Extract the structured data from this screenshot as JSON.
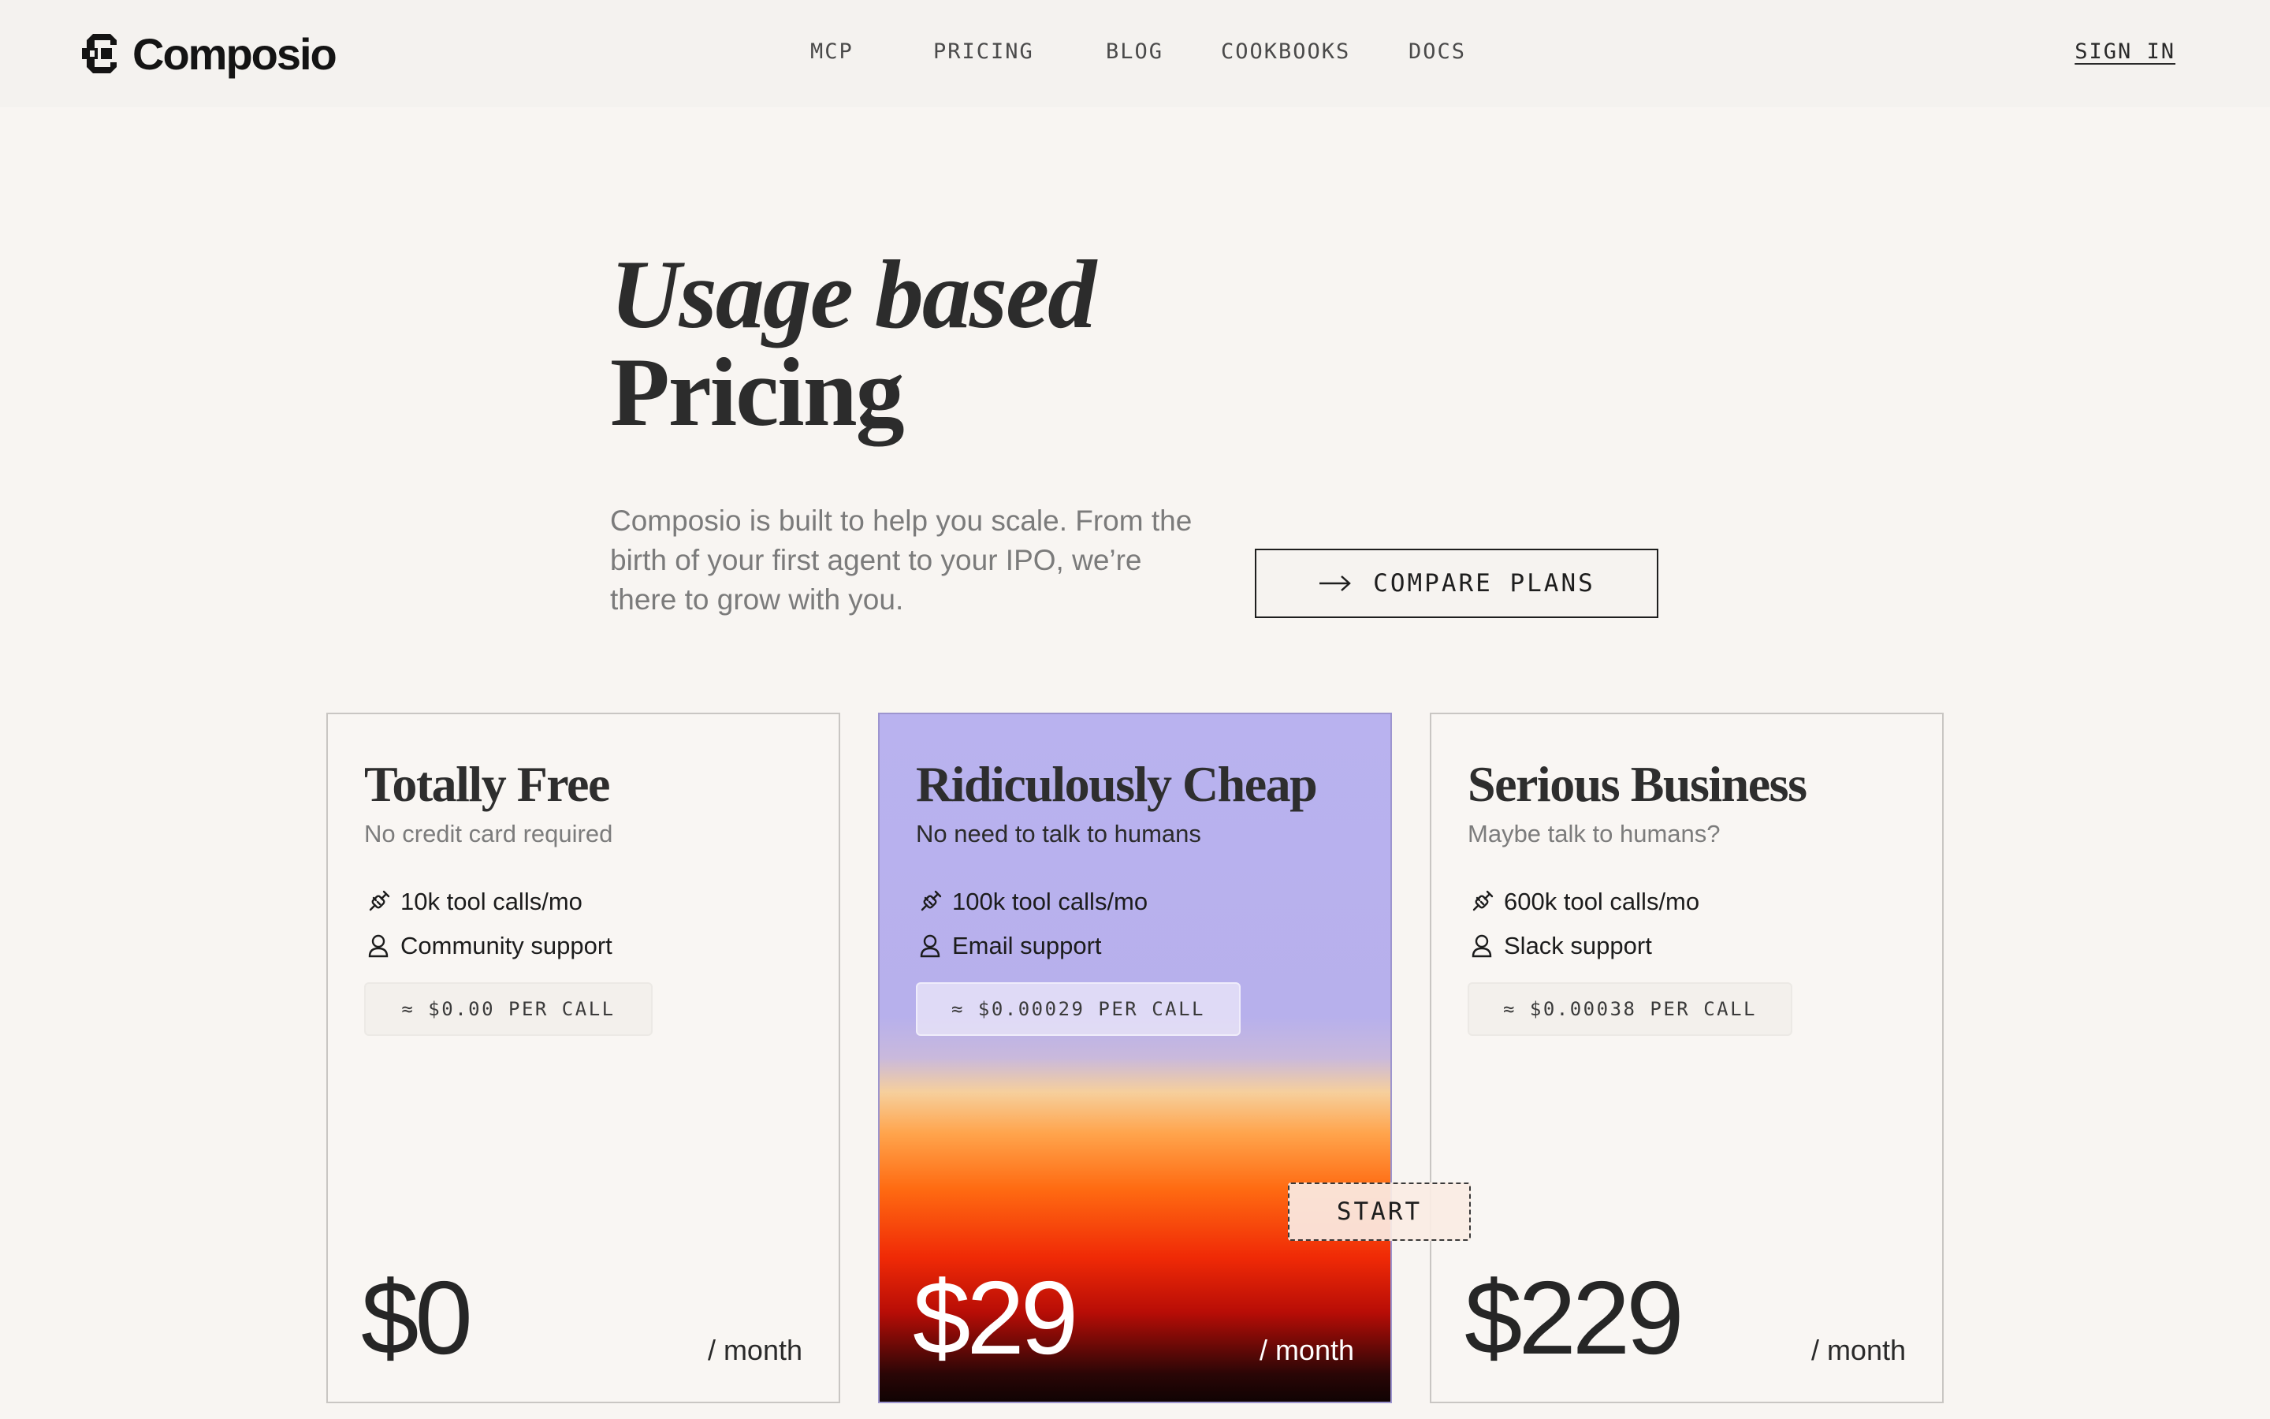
{
  "brand": {
    "name": "Composio",
    "logo_icon": "composio-logo-icon"
  },
  "nav": {
    "links": [
      {
        "label": "MCP"
      },
      {
        "label": "PRICING"
      },
      {
        "label": "BLOG"
      },
      {
        "label": "COOKBOOKS"
      },
      {
        "label": "DOCS"
      }
    ],
    "sign_in": "SIGN IN"
  },
  "hero": {
    "title_line1": "Usage based",
    "title_line2": "Pricing",
    "description": "Composio is built to help you scale. From the birth of your first agent to your IPO, we’re there to grow with you.",
    "compare_button": "COMPARE PLANS",
    "compare_icon": "arrow-right-icon"
  },
  "plans": [
    {
      "title": "Totally Free",
      "subtitle": "No credit card required",
      "features": [
        {
          "icon": "plug-icon",
          "label": "10k tool calls/mo"
        },
        {
          "icon": "user-icon",
          "label": "Community support"
        }
      ],
      "per_call": "≈ $0.00 PER CALL",
      "price": "$0",
      "period": "/ month"
    },
    {
      "title": "Ridiculously Cheap",
      "subtitle": "No need to talk to humans",
      "features": [
        {
          "icon": "plug-icon",
          "label": "100k tool calls/mo"
        },
        {
          "icon": "user-icon",
          "label": "Email support"
        }
      ],
      "per_call": "≈ $0.00029 PER CALL",
      "price": "$29",
      "period": "/ month",
      "highlight_colors": [
        "#b9b2ef",
        "#ff6b12",
        "#f02a06",
        "#100303"
      ]
    },
    {
      "title": "Serious Business",
      "subtitle": "Maybe talk to humans?",
      "features": [
        {
          "icon": "plug-icon",
          "label": "600k tool calls/mo"
        },
        {
          "icon": "user-icon",
          "label": "Slack support"
        }
      ],
      "per_call": "≈ $0.00038 PER CALL",
      "price": "$229",
      "period": "/ month"
    }
  ],
  "start_button": "START",
  "colors": {
    "background": "#f8f5f2",
    "text": "#1f1f1f",
    "accent_lavender": "#b9b2ef"
  }
}
